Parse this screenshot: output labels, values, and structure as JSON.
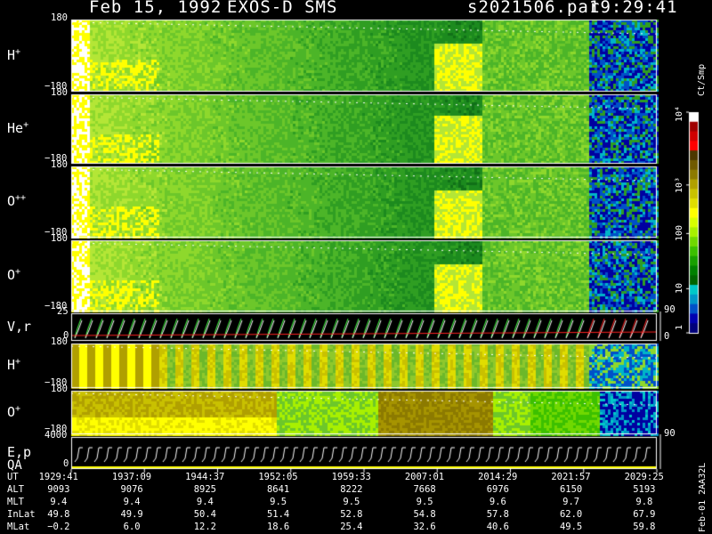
{
  "header": {
    "date": "Feb 15, 1992",
    "instrument": "EXOS-D SMS",
    "file": "s2021506.par",
    "time": "19:29:41"
  },
  "chart_data": {
    "type": "heatmap",
    "panels": [
      {
        "label": "H",
        "sup": "+",
        "ytop": "180",
        "ybot": "−180"
      },
      {
        "label": "He",
        "sup": "+",
        "ytop": "180",
        "ybot": "−180"
      },
      {
        "label": "O",
        "sup": "++",
        "ytop": "180",
        "ybot": "−180"
      },
      {
        "label": "O",
        "sup": "+",
        "ytop": "180",
        "ybot": "−180"
      },
      {
        "label": "V,r",
        "sup": "",
        "ytop": "25",
        "ybot": "0"
      },
      {
        "label": "H",
        "sup": "+",
        "ytop": "180",
        "ybot": "−180"
      },
      {
        "label": "O",
        "sup": "+",
        "ytop": "180",
        "ybot": "−180"
      },
      {
        "label": "E,p",
        "label2": "QA",
        "sup": "",
        "ytop": "4000",
        "ybot": "0"
      }
    ],
    "colorbar": {
      "title": "Ct/Smp",
      "labels": [
        "10⁴",
        "10³",
        "100",
        "10",
        "1"
      ],
      "colors": [
        "#ffffff",
        "#a00000",
        "#d00000",
        "#ff0000",
        "#4c3800",
        "#705a00",
        "#8c7a00",
        "#b0a000",
        "#c9c100",
        "#e0dd00",
        "#ffff00",
        "#d8ff00",
        "#a8f000",
        "#70d800",
        "#3cc000",
        "#18a000",
        "#008000",
        "#006400",
        "#00c8c8",
        "#0096c8",
        "#0050c8",
        "#0000b0",
        "#00007a"
      ]
    },
    "right_axis": {
      "a_top": "90",
      "a_bot": "0",
      "b_top": "90"
    },
    "ut_ticks": [
      "1929:41",
      "1937:09",
      "1944:37",
      "1952:05",
      "1959:33",
      "2007:01",
      "2014:29",
      "2021:57",
      "2029:25"
    ]
  },
  "ephemeris": [
    {
      "name": "UT",
      "values": [
        "1929:41",
        "1937:09",
        "1944:37",
        "1952:05",
        "1959:33",
        "2007:01",
        "2014:29",
        "2021:57",
        "2029:25"
      ]
    },
    {
      "name": "ALT",
      "values": [
        "9093",
        "9076",
        "8925",
        "8641",
        "8222",
        "7668",
        "6976",
        "6150",
        "5193"
      ]
    },
    {
      "name": "MLT",
      "values": [
        "9.4",
        "9.4",
        "9.4",
        "9.5",
        "9.5",
        "9.5",
        "9.6",
        "9.7",
        "9.8"
      ]
    },
    {
      "name": "InLat",
      "values": [
        "49.8",
        "49.9",
        "50.4",
        "51.4",
        "52.8",
        "54.8",
        "57.8",
        "62.0",
        "67.9"
      ]
    },
    {
      "name": "MLat",
      "values": [
        "−0.2",
        "6.0",
        "12.2",
        "18.6",
        "25.4",
        "32.6",
        "40.6",
        "49.5",
        "59.8"
      ]
    }
  ],
  "footer_rot": "Feb-01 2AA32L"
}
